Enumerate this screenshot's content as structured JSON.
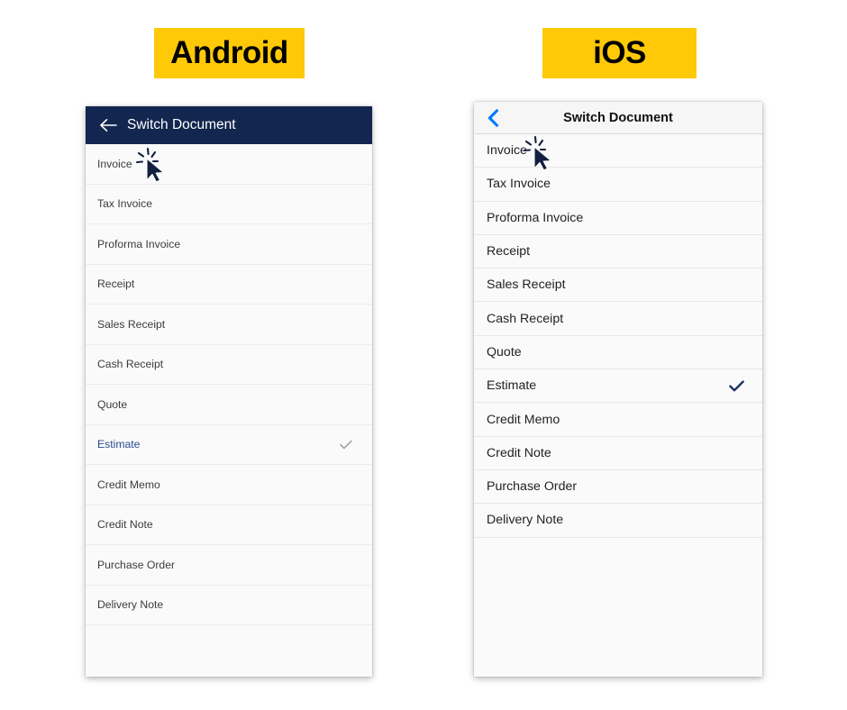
{
  "badges": {
    "android": "Android",
    "ios": "iOS",
    "background_color": "#ffc907",
    "text_color": "#000000"
  },
  "android": {
    "header": {
      "title": "Switch Document",
      "back_icon": "arrow-left-icon",
      "background_color": "#12264f",
      "text_color": "#ffffff"
    },
    "selected_item": "Estimate",
    "selected_text_color": "#2a4b8d",
    "check_color": "#9a9a9a",
    "items": [
      {
        "label": "Invoice",
        "selected": false
      },
      {
        "label": "Tax Invoice",
        "selected": false
      },
      {
        "label": "Proforma Invoice",
        "selected": false
      },
      {
        "label": "Receipt",
        "selected": false
      },
      {
        "label": "Sales Receipt",
        "selected": false
      },
      {
        "label": "Cash Receipt",
        "selected": false
      },
      {
        "label": "Quote",
        "selected": false
      },
      {
        "label": "Estimate",
        "selected": true
      },
      {
        "label": "Credit Memo",
        "selected": false
      },
      {
        "label": "Credit Note",
        "selected": false
      },
      {
        "label": "Purchase Order",
        "selected": false
      },
      {
        "label": "Delivery Note",
        "selected": false
      }
    ]
  },
  "ios": {
    "header": {
      "title": "Switch Document",
      "back_icon": "chevron-left-icon",
      "background_color": "#f6f6f6",
      "text_color": "#111111",
      "back_icon_color": "#007aff"
    },
    "selected_item": "Estimate",
    "check_color": "#1a3263",
    "items": [
      {
        "label": "Invoice",
        "selected": false
      },
      {
        "label": "Tax Invoice",
        "selected": false
      },
      {
        "label": "Proforma Invoice",
        "selected": false
      },
      {
        "label": "Receipt",
        "selected": false
      },
      {
        "label": "Sales Receipt",
        "selected": false
      },
      {
        "label": "Cash Receipt",
        "selected": false
      },
      {
        "label": "Quote",
        "selected": false
      },
      {
        "label": "Estimate",
        "selected": true
      },
      {
        "label": "Credit Memo",
        "selected": false
      },
      {
        "label": "Credit Note",
        "selected": false
      },
      {
        "label": "Purchase Order",
        "selected": false
      },
      {
        "label": "Delivery Note",
        "selected": false
      }
    ]
  },
  "cursors": {
    "android": {
      "target_item": "Invoice",
      "icon": "click-cursor-icon"
    },
    "ios": {
      "target_item": "Invoice",
      "icon": "click-cursor-icon"
    }
  }
}
